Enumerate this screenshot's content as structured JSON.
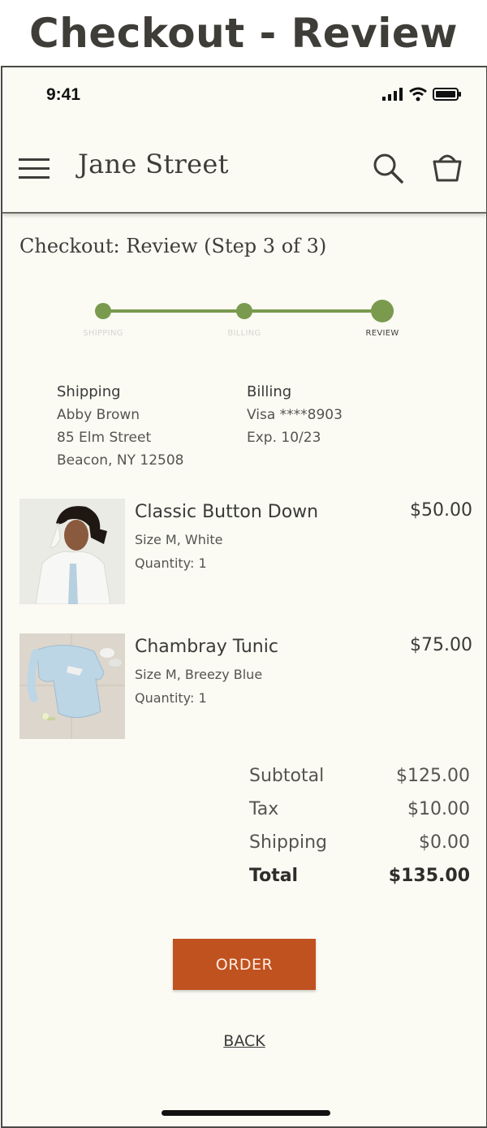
{
  "page_heading": "Checkout - Review",
  "status_bar": {
    "time": "9:41"
  },
  "header": {
    "brand": "Jane Street"
  },
  "checkout": {
    "title": "Checkout: Review (Step 3 of 3)"
  },
  "progress": {
    "steps": [
      {
        "label": "SHIPPING",
        "state": "completed"
      },
      {
        "label": "BILLING",
        "state": "completed"
      },
      {
        "label": "REVIEW",
        "state": "current"
      }
    ]
  },
  "shipping": {
    "heading": "Shipping",
    "name": "Abby Brown",
    "street": "85 Elm Street",
    "city": "Beacon, NY 12508"
  },
  "billing": {
    "heading": "Billing",
    "card": "Visa ****8903",
    "expiry": "Exp. 10/23"
  },
  "items": [
    {
      "name": "Classic Button Down",
      "variant": "Size M, White",
      "quantity": "Quantity: 1",
      "price": "$50.00"
    },
    {
      "name": "Chambray Tunic",
      "variant": "Size M, Breezy Blue",
      "quantity": "Quantity: 1",
      "price": "$75.00"
    }
  ],
  "totals": {
    "subtotal_label": "Subtotal",
    "subtotal": "$125.00",
    "tax_label": "Tax",
    "tax": "$10.00",
    "shipping_label": "Shipping",
    "shipping": "$0.00",
    "total_label": "Total",
    "total": "$135.00"
  },
  "actions": {
    "order_label": "ORDER",
    "back_label": "BACK"
  },
  "colors": {
    "accent_green": "#7a9a4e",
    "order_button": "#c0521f",
    "background": "#fbfbf4"
  }
}
